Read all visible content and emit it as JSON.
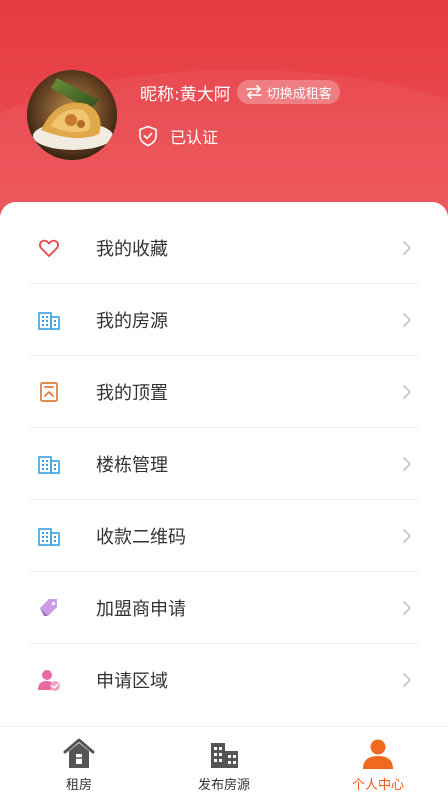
{
  "profile": {
    "nickname": "昵称:黄大阿",
    "switch_label": "切换成租客",
    "verified_label": "已认证"
  },
  "menu": {
    "items": [
      {
        "label": "我的收藏",
        "icon": "heart-icon"
      },
      {
        "label": "我的房源",
        "icon": "building-icon"
      },
      {
        "label": "我的顶置",
        "icon": "pin-top-icon"
      },
      {
        "label": "楼栋管理",
        "icon": "building-icon"
      },
      {
        "label": "收款二维码",
        "icon": "building-icon"
      },
      {
        "label": "加盟商申请",
        "icon": "tag-icon"
      },
      {
        "label": "申请区域",
        "icon": "user-check-icon"
      }
    ]
  },
  "tabbar": {
    "tabs": [
      {
        "label": "租房",
        "icon": "house-icon",
        "active": false
      },
      {
        "label": "发布房源",
        "icon": "buildings-icon",
        "active": false
      },
      {
        "label": "个人中心",
        "icon": "person-icon",
        "active": true
      }
    ]
  },
  "colors": {
    "header_red": "#e8454c",
    "active_tab": "#f05a1a",
    "heart": "#e8454c",
    "building_blue": "#3aa0e0",
    "pin_orange": "#e07a3a",
    "tag_purple": "#b07ad8",
    "user_pink": "#e86aa0"
  }
}
